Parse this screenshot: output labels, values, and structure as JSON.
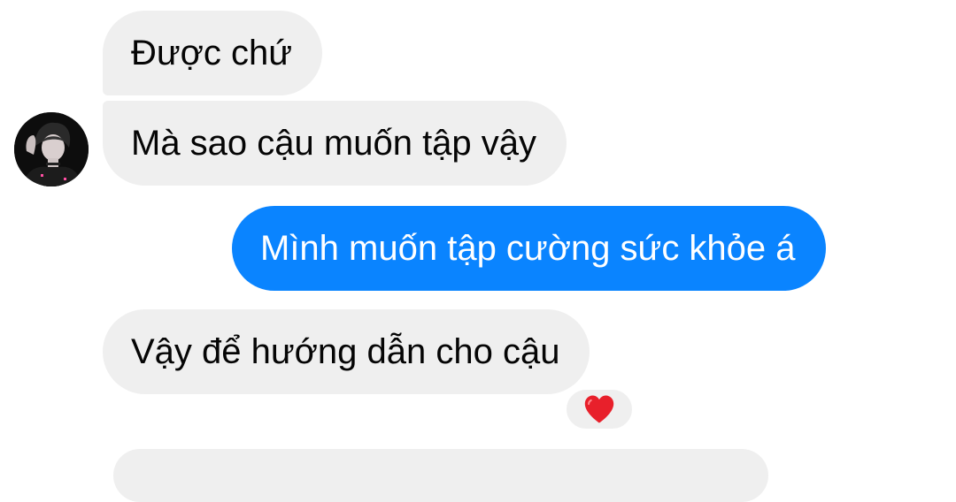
{
  "conversation": {
    "messages": [
      {
        "text": "Được chứ",
        "direction": "received"
      },
      {
        "text": "Mà sao cậu muốn tập vậy",
        "direction": "received"
      },
      {
        "text": "Mình muốn tập cường sức khỏe á",
        "direction": "sent"
      },
      {
        "text": "Vậy để hướng dẫn cho cậu",
        "direction": "received",
        "reaction": "heart"
      },
      {
        "text": "",
        "direction": "received"
      }
    ]
  },
  "contact": {
    "avatar_icon": "person-photo-icon"
  },
  "colors": {
    "sent_bubble": "#0a84ff",
    "received_bubble": "#efefef",
    "reaction_heart": "#e8202b"
  }
}
